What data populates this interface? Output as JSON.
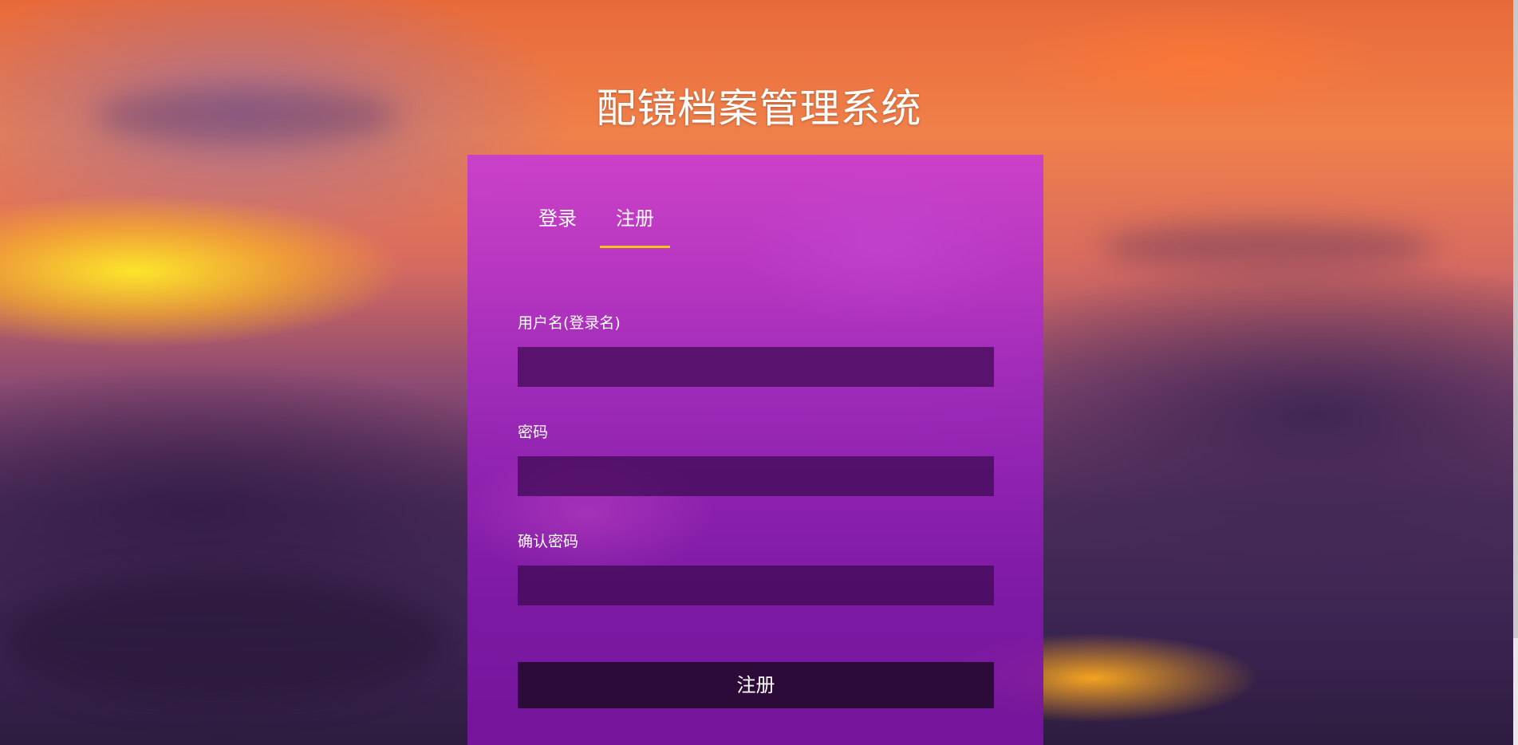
{
  "page": {
    "title": "配镜档案管理系统"
  },
  "tabs": [
    {
      "label": "登录",
      "active": false
    },
    {
      "label": "注册",
      "active": true
    }
  ],
  "form": {
    "username_label": "用户名(登录名)",
    "username_value": "",
    "password_label": "密码",
    "password_value": "",
    "confirm_label": "确认密码",
    "confirm_value": "",
    "submit_label": "注册"
  },
  "colors": {
    "tab_underline": "#f5c518",
    "panel": "#a028be",
    "input_bg": "#3c0a50",
    "button_bg": "#230a2d"
  }
}
